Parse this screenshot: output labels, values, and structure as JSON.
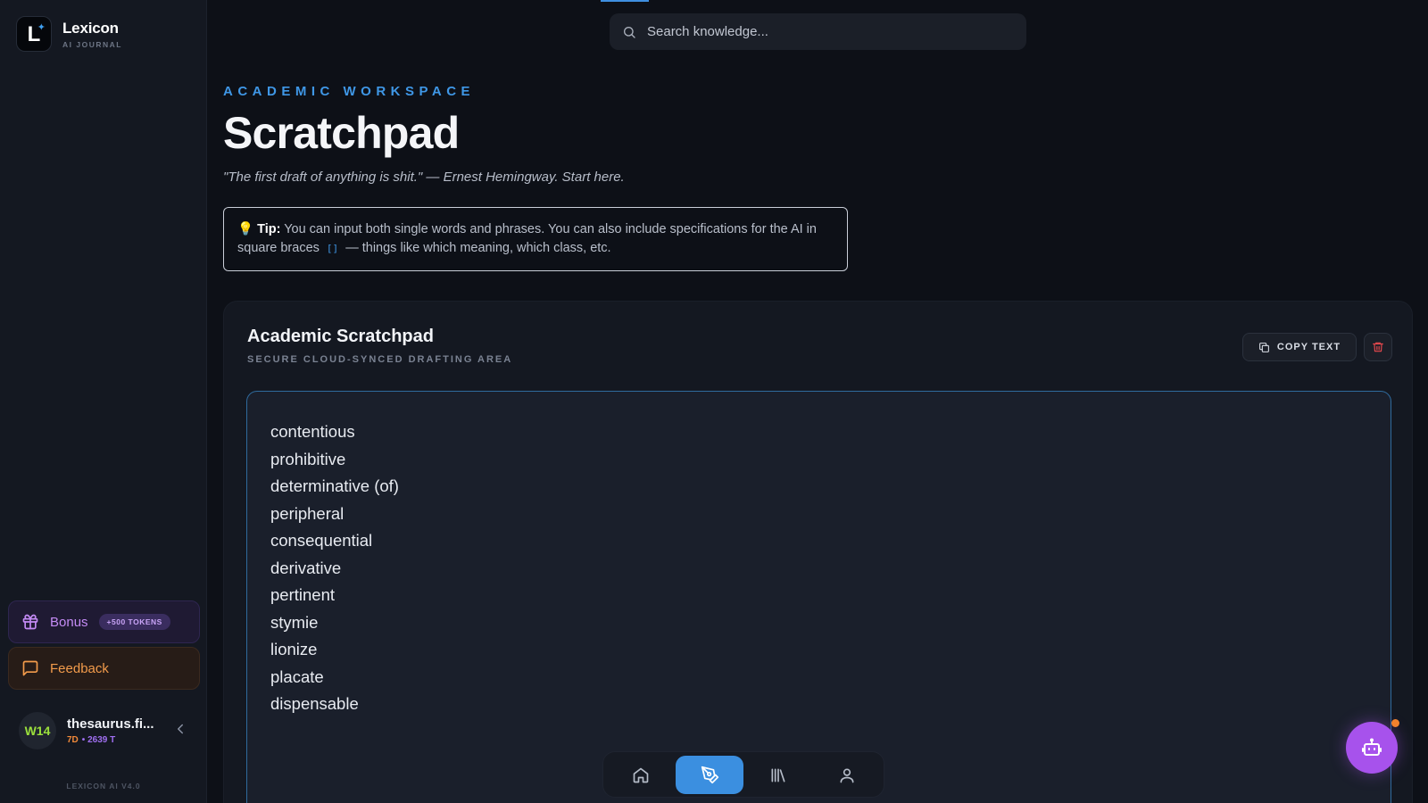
{
  "brand": {
    "logo_letter": "L",
    "name": "Lexicon",
    "subtitle": "AI JOURNAL"
  },
  "sidebar": {
    "bonus": {
      "label": "Bonus",
      "badge": "+500 TOKENS"
    },
    "feedback": {
      "label": "Feedback"
    },
    "user": {
      "avatar_text": "W14",
      "name": "thesaurus.fi...",
      "streak": "7D",
      "tokens": "• 2639 T"
    },
    "version": "LEXICON AI V4.0"
  },
  "search": {
    "placeholder": "Search knowledge..."
  },
  "header": {
    "eyebrow": "ACADEMIC WORKSPACE",
    "title": "Scratchpad",
    "quote": "\"The first draft of anything is shit.\" — Ernest Hemingway. Start here."
  },
  "tip": {
    "label": "Tip:",
    "text_1": "You can input both single words and phrases. You can also include specifications for the AI in square braces",
    "code": "[]",
    "text_2": "— things like which meaning, which class, etc."
  },
  "card": {
    "title": "Academic Scratchpad",
    "subtitle": "SECURE CLOUD-SYNCED DRAFTING AREA",
    "copy_label": "COPY TEXT",
    "words": [
      "contentious",
      "prohibitive",
      "determinative (of)",
      "peripheral",
      "consequential",
      "derivative",
      "pertinent",
      "stymie",
      "lionize",
      "placate",
      "dispensable"
    ]
  },
  "bottom_nav": {
    "items": [
      "home-icon",
      "pen-icon",
      "library-icon",
      "user-icon"
    ],
    "active": "pen-icon"
  },
  "colors": {
    "accent": "#3b8fe0",
    "bonus": "#c48bf5",
    "feedback": "#f29b4b",
    "fab": "#a752ec",
    "trash": "#e5484d"
  }
}
